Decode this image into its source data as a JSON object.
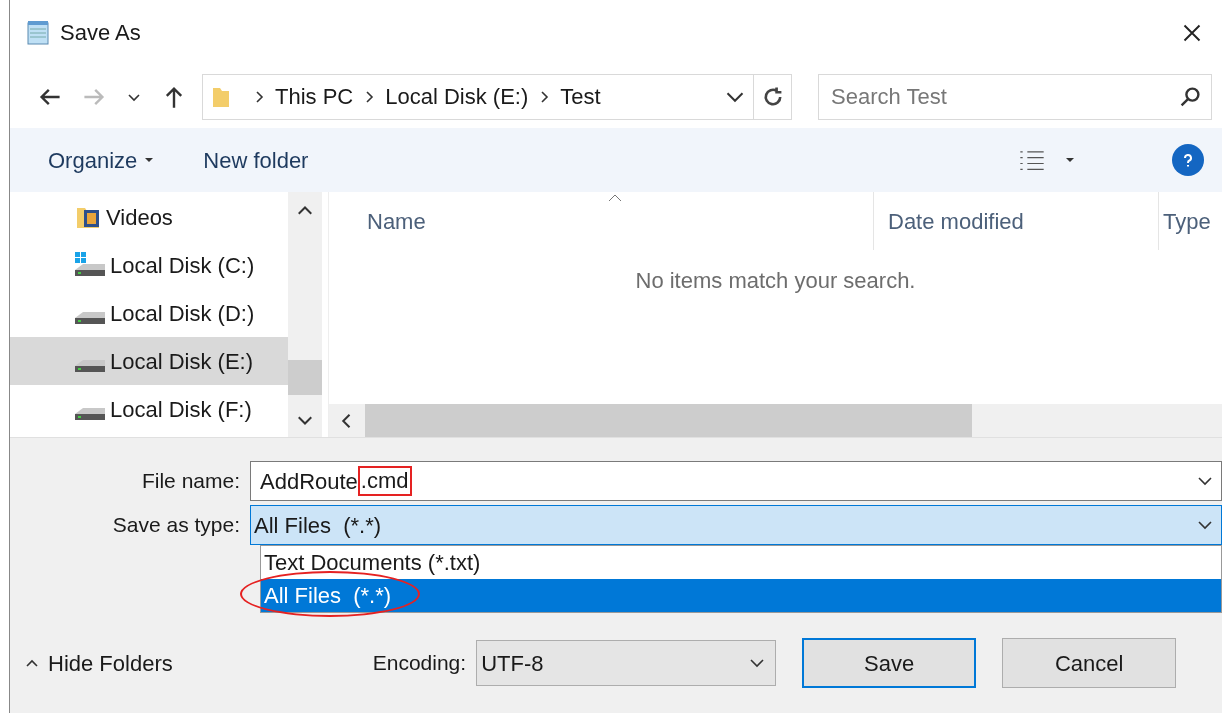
{
  "window": {
    "title": "Save As"
  },
  "navigation": {
    "breadcrumb": [
      "This PC",
      "Local Disk (E:)",
      "Test"
    ],
    "search": {
      "placeholder": "Search Test"
    }
  },
  "toolbar": {
    "buttons": [
      {
        "label": "Organize",
        "has_menu": true
      },
      {
        "label": "New folder",
        "has_menu": false
      }
    ]
  },
  "sidebar": {
    "items": [
      {
        "label": "Videos",
        "kind": "videos",
        "selected": false
      },
      {
        "label": "Local Disk (C:)",
        "kind": "system-drive",
        "selected": false
      },
      {
        "label": "Local Disk (D:)",
        "kind": "drive",
        "selected": false
      },
      {
        "label": "Local Disk (E:)",
        "kind": "drive",
        "selected": true
      },
      {
        "label": "Local Disk (F:)",
        "kind": "drive",
        "selected": false
      }
    ]
  },
  "file_list": {
    "columns": [
      {
        "label": "Name",
        "sorted": true
      },
      {
        "label": "Date modified",
        "sorted": false
      },
      {
        "label": "Type",
        "sorted": false
      }
    ],
    "empty_message": "No items match your search."
  },
  "form": {
    "file_name": {
      "label": "File name:",
      "value": "AddRoute",
      "annotated_suffix": ".cmd"
    },
    "save_as_type": {
      "label": "Save as type:",
      "value": "All Files  (*.*)",
      "expanded": true,
      "options": [
        {
          "label": "Text Documents (*.txt)",
          "selected": false,
          "annotated": false
        },
        {
          "label": "All Files  (*.*)",
          "selected": true,
          "annotated": true
        }
      ]
    }
  },
  "footer": {
    "hide_folders": "Hide Folders",
    "encoding": {
      "label": "Encoding:",
      "value": "UTF-8"
    },
    "buttons": [
      {
        "label": "Save",
        "default": true
      },
      {
        "label": "Cancel",
        "default": false
      }
    ]
  }
}
